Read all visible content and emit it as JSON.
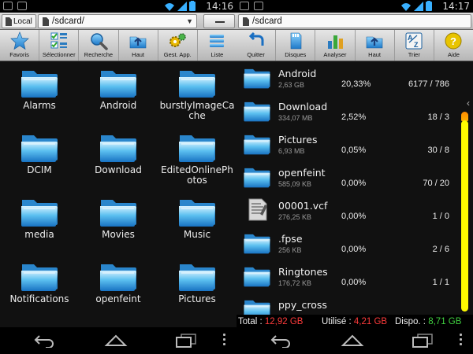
{
  "left": {
    "status": {
      "time": "14:16"
    },
    "location_label": "Local",
    "path": "/sdcard/",
    "toolbar": [
      {
        "label": "Favoris",
        "icon": "star-icon"
      },
      {
        "label": "Sélectionner",
        "icon": "select-icon"
      },
      {
        "label": "Recherche",
        "icon": "search-icon"
      },
      {
        "label": "Haut",
        "icon": "folder-up-icon"
      },
      {
        "label": "Gest. App.",
        "icon": "app-manager-icon"
      },
      {
        "label": "Liste",
        "icon": "list-view-icon"
      }
    ],
    "folders": [
      [
        "Alarms"
      ],
      [
        "Android"
      ],
      [
        "burstlyImageCa",
        "che"
      ],
      [
        "DCIM"
      ],
      [
        "Download"
      ],
      [
        "EditedOnlinePh",
        "otos"
      ],
      [
        "media"
      ],
      [
        "Movies"
      ],
      [
        "Music"
      ],
      [
        "Notifications"
      ],
      [
        "openfeint"
      ],
      [
        "Pictures"
      ]
    ]
  },
  "right": {
    "status": {
      "time": "14:17"
    },
    "path": "/sdcard",
    "toolbar": [
      {
        "label": "Quitter",
        "icon": "exit-icon"
      },
      {
        "label": "Disques",
        "icon": "disks-icon"
      },
      {
        "label": "Analyser",
        "icon": "analyze-icon"
      },
      {
        "label": "Haut",
        "icon": "folder-up-icon"
      },
      {
        "label": "Trier",
        "icon": "sort-icon"
      },
      {
        "label": "Aide",
        "icon": "help-icon"
      }
    ],
    "items": [
      {
        "name": "Android",
        "size": "2,63 GB",
        "percent": "20,33%",
        "count": "6177 / 786",
        "type": "folder"
      },
      {
        "name": "Download",
        "size": "334,07 MB",
        "percent": "2,52%",
        "count": "18 / 3",
        "type": "folder"
      },
      {
        "name": "Pictures",
        "size": "6,93 MB",
        "percent": "0,05%",
        "count": "30 / 8",
        "type": "folder"
      },
      {
        "name": "openfeint",
        "size": "585,09 KB",
        "percent": "0,00%",
        "count": "70 / 20",
        "type": "folder"
      },
      {
        "name": "00001.vcf",
        "size": "276,25 KB",
        "percent": "0,00%",
        "count": "1 / 0",
        "type": "file"
      },
      {
        "name": ".fpse",
        "size": "256 KB",
        "percent": "0,00%",
        "count": "2 / 6",
        "type": "folder"
      },
      {
        "name": "Ringtones",
        "size": "176,72 KB",
        "percent": "0,00%",
        "count": "1 / 1",
        "type": "folder"
      },
      {
        "name": "ppy_cross",
        "size": "",
        "percent": "",
        "count": "",
        "type": "folder"
      }
    ],
    "totals": {
      "total_label": "Total :",
      "total_value": "12,92 GB",
      "used_label": "Utilisé :",
      "used_value": "4,21 GB",
      "free_label": "Dispo. :",
      "free_value": "8,71 GB"
    }
  },
  "colors": {
    "total": "#ff3b3b",
    "used": "#ff3b3b",
    "free": "#40d040",
    "accent_scroll": "#fffb00"
  }
}
